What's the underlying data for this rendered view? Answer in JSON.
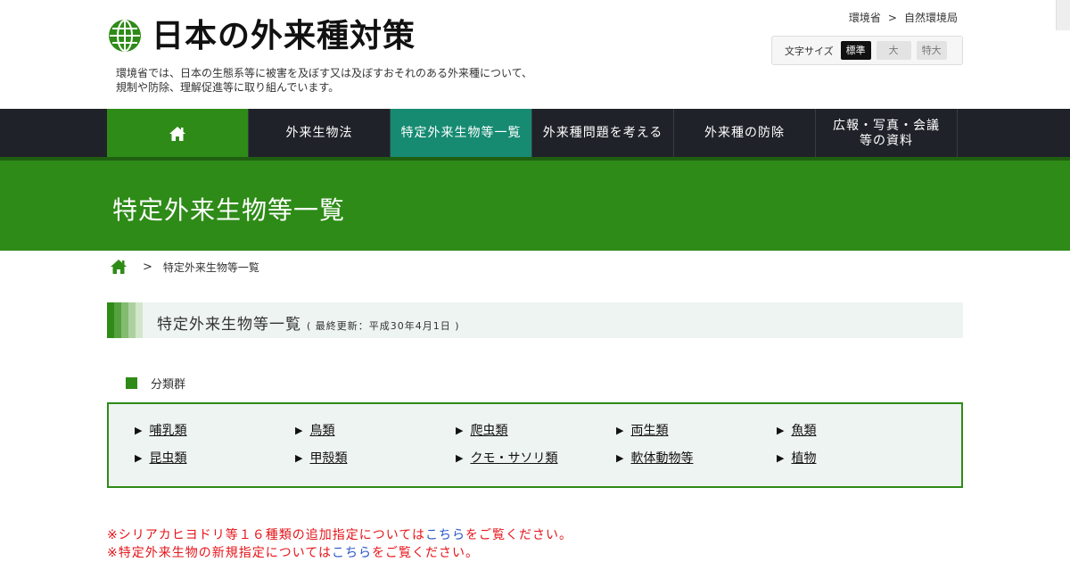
{
  "site": {
    "title": "日本の外来種対策",
    "description_line1": "環境省では、日本の生態系等に被害を及ぼす又は及ぼすおそれのある外来種について、",
    "description_line2": "規制や防除、理解促進等に取り組んでいます。"
  },
  "ministry_breadcrumb": {
    "ministry": "環境省",
    "separator": ">",
    "bureau": "自然環境局"
  },
  "font_size": {
    "label": "文字サイズ",
    "options": [
      "標準",
      "大",
      "特大"
    ],
    "selected": "標準"
  },
  "nav": {
    "home_icon": "home-icon",
    "items": [
      {
        "label": "外来生物法"
      },
      {
        "label": "特定外来生物等一覧"
      },
      {
        "label": "外来種問題を考える"
      },
      {
        "label": "外来種の防除"
      },
      {
        "label_line1": "広報・写真・会議",
        "label_line2": "等の資料"
      }
    ],
    "active": "特定外来生物等一覧"
  },
  "hero": {
    "title": "特定外来生物等一覧"
  },
  "breadcrumb": {
    "separator": ">",
    "current": "特定外来生物等一覧"
  },
  "section": {
    "heading": "特定外来生物等一覧",
    "updated": "( 最終更新：平成30年4月1日 )"
  },
  "classification": {
    "label": "分類群",
    "items": [
      "哺乳類",
      "鳥類",
      "爬虫類",
      "両生類",
      "魚類",
      "昆虫類",
      "甲殻類",
      "クモ・サソリ類",
      "軟体動物等",
      "植物"
    ]
  },
  "notes": {
    "note1_before": "※シリアカヒヨドリ等１６種類の追加指定については",
    "note1_link": "こちら",
    "note1_after": "をご覧ください。",
    "note2_before": "※特定外来生物の新規指定については",
    "note2_link": "こちら",
    "note2_after": "をご覧ください。"
  },
  "colors": {
    "brand_green": "#2e8b17",
    "nav_dark": "#20222a",
    "nav_active": "#168b72",
    "note_red": "#e5141a",
    "link_blue": "#2855c8"
  }
}
